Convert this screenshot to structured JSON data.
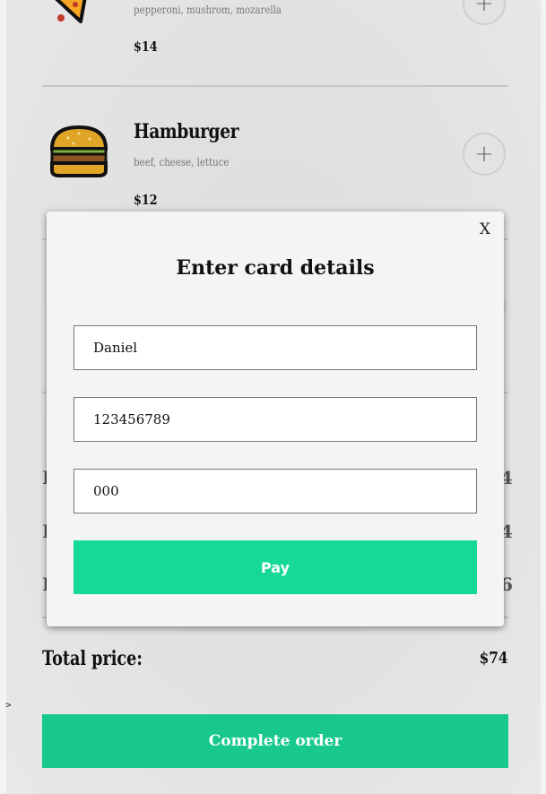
{
  "menu": {
    "items": [
      {
        "name": "",
        "description": "pepperoni, mushrom, mozarella",
        "price": "$14",
        "icon": "pizza-icon"
      },
      {
        "name": "Hamburger",
        "description": "beef, cheese, lettuce",
        "price": "$12",
        "icon": "hamburger-icon"
      }
    ],
    "add_glyph": "+"
  },
  "summary": {
    "total_label": "Total price:",
    "total_value": "$74"
  },
  "complete_button": "Complete order",
  "caret": ">",
  "modal": {
    "close_label": "X",
    "title": "Enter card details",
    "name_value": "Daniel",
    "card_number_value": "123456789",
    "cvv_value": "000",
    "pay_label": "Pay"
  },
  "colors": {
    "accent": "#19c98b",
    "pay_accent": "#17d996"
  }
}
